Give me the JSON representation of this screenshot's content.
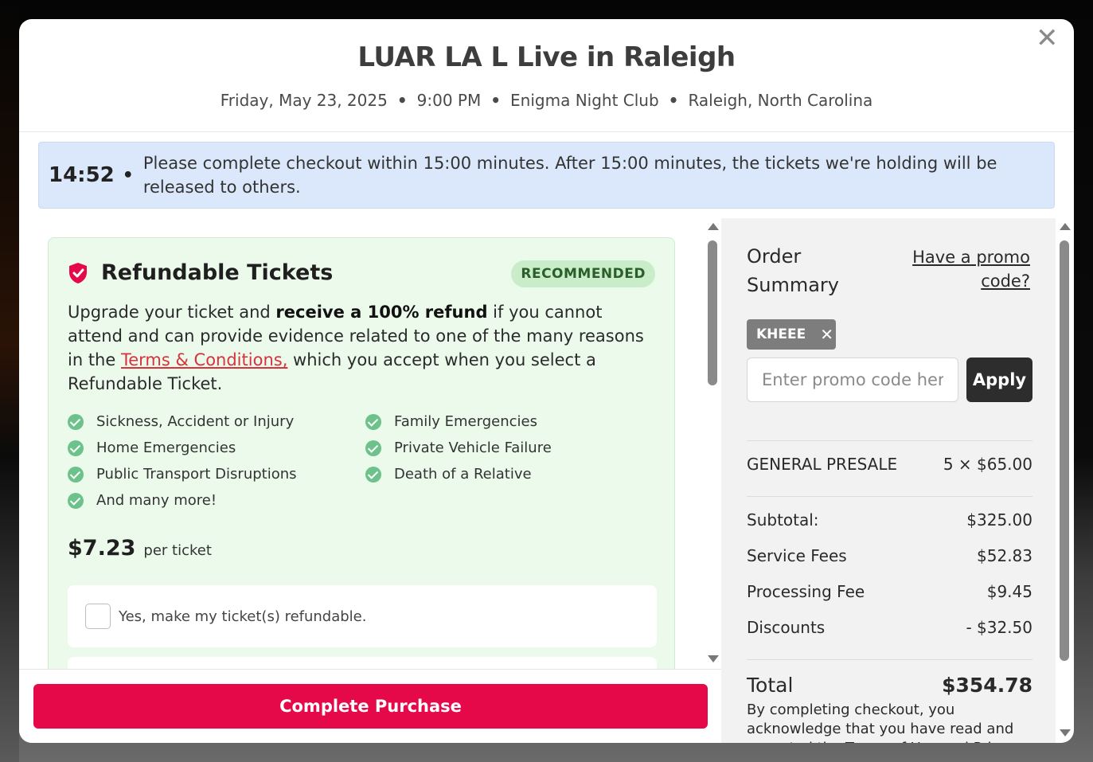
{
  "header": {
    "title": "LUAR LA L Live in Raleigh",
    "date": "Friday, May 23, 2025",
    "time": "9:00 PM",
    "venue": "Enigma Night Club",
    "location": "Raleigh, North Carolina",
    "separator": "•"
  },
  "close_glyph": "✕",
  "timer": {
    "time": "14:52",
    "dot": "•",
    "message": "Please complete checkout within 15:00 minutes. After 15:00 minutes, the tickets we're holding will be released to others."
  },
  "refund": {
    "title": "Refundable Tickets",
    "badge": "RECOMMENDED",
    "desc_pre": "Upgrade your ticket and ",
    "desc_bold": "receive a 100% refund",
    "desc_mid": " if you cannot attend and can provide evidence related to one of the many reasons in the ",
    "terms_link": "Terms & Conditions,",
    "desc_post": " which you accept when you select a Refundable Ticket.",
    "reasons_left": [
      "Sickness, Accident or Injury",
      "Home Emergencies",
      "Public Transport Disruptions",
      "And many more!"
    ],
    "reasons_right": [
      "Family Emergencies",
      "Private Vehicle Failure",
      "Death of a Relative"
    ],
    "price": "$7.23",
    "price_unit": "per ticket",
    "option_label": "Yes, make my ticket(s) refundable."
  },
  "footer": {
    "purchase_label": "Complete Purchase"
  },
  "summary": {
    "title": "Order Summary",
    "promo_link": "Have a promo code?",
    "promo_chip": "KHEEE",
    "promo_chip_remove": "✕",
    "promo_placeholder": "Enter promo code here",
    "apply_label": "Apply",
    "ticket_name": "GENERAL PRESALE",
    "ticket_qty_price": "5 × $65.00",
    "subtotal_label": "Subtotal:",
    "subtotal_value": "$325.00",
    "service_label": "Service Fees",
    "service_value": "$52.83",
    "processing_label": "Processing Fee",
    "processing_value": "$9.45",
    "discounts_label": "Discounts",
    "discounts_value": "- $32.50",
    "total_label": "Total",
    "total_value": "$354.78",
    "disclaimer": "By completing checkout, you acknowledge that you have read and accepted the Terms of Use and Privacy Policy"
  },
  "colors": {
    "accent": "#e5094a",
    "banner": "#dbe8fb",
    "refund_bg": "#ebfaeb",
    "check": "#6cc28a",
    "link_red": "#d9323c"
  }
}
